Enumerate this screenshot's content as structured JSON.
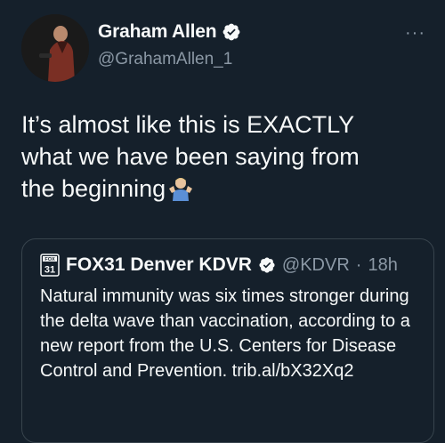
{
  "author": {
    "display_name": "Graham Allen",
    "handle": "@GrahamAllen_1",
    "avatar_icon": "profile-photo"
  },
  "more_icon": "···",
  "tweet": {
    "text": "It’s almost like this is EXACTLY\nwhat we have been saying from\nthe beginning",
    "emoji": "person-shrugging-emoji"
  },
  "quote": {
    "logo": "FOX 31",
    "display_name": "FOX31 Denver KDVR",
    "handle": "@KDVR",
    "separator": "·",
    "time": "18h",
    "text": "Natural immunity was six times stronger during the delta wave than vaccination, according to a new report from the U.S. Centers for Disease Control and Prevention. trib.al/bX32Xq2"
  },
  "colors": {
    "background": "#15202b",
    "text": "#f7f9f9",
    "secondary": "#8b98a5",
    "verified": "#1d9bf0",
    "border": "#38444d"
  }
}
